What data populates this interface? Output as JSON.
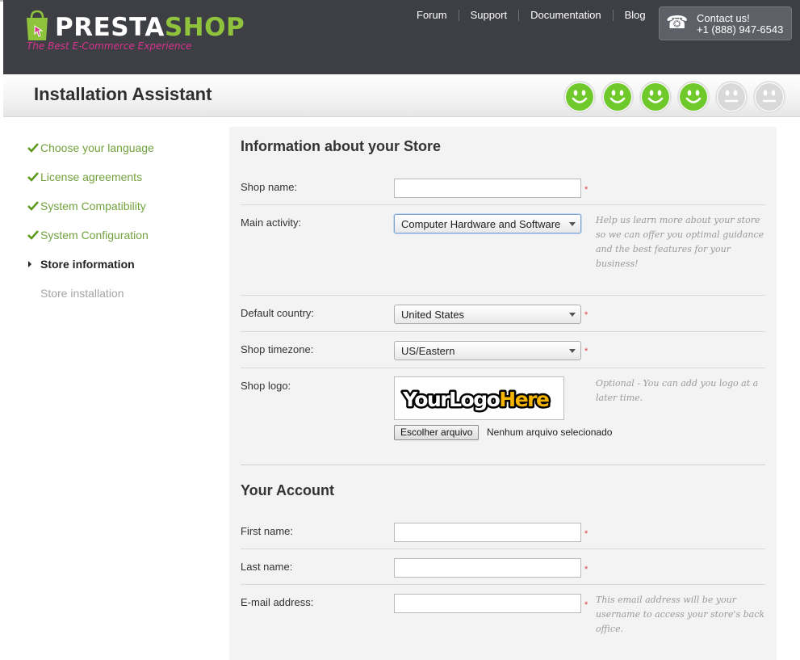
{
  "header": {
    "logo_word_1": "PRESTA",
    "logo_word_2": "SHOP",
    "logo_tagline": "The Best E-Commerce Experience",
    "nav": [
      {
        "label": "Forum"
      },
      {
        "label": "Support"
      },
      {
        "label": "Documentation"
      },
      {
        "label": "Blog"
      }
    ],
    "contact_label": "Contact us!",
    "contact_phone": "+1 (888) 947-6543"
  },
  "title": "Installation Assistant",
  "progress": {
    "completed": 4,
    "total": 6
  },
  "steps": [
    {
      "label": "Choose your language",
      "state": "done"
    },
    {
      "label": "License agreements",
      "state": "done"
    },
    {
      "label": "System Compatibility",
      "state": "done"
    },
    {
      "label": "System Configuration",
      "state": "done"
    },
    {
      "label": "Store information",
      "state": "current"
    },
    {
      "label": "Store installation",
      "state": "future"
    }
  ],
  "store": {
    "title": "Information about your Store",
    "shop_name_label": "Shop name:",
    "shop_name_value": "",
    "activity_label": "Main activity:",
    "activity_value": "Computer Hardware and Software",
    "activity_hint": "Help us learn more about your store so we can offer you optimal guidance and the best features for your business!",
    "country_label": "Default country:",
    "country_value": "United States",
    "timezone_label": "Shop timezone:",
    "timezone_value": "US/Eastern",
    "logo_label": "Shop logo:",
    "logo_text_1": "YourLogo",
    "logo_text_2": "Here",
    "logo_hint": "Optional - You can add you logo at a later time.",
    "file_button": "Escolher arquivo",
    "file_none": "Nenhum arquivo selecionado",
    "required_mark": "*"
  },
  "account": {
    "title": "Your Account",
    "first_name_label": "First name:",
    "last_name_label": "Last name:",
    "email_label": "E-mail address:",
    "email_hint": "This email address will be your username to access your store's back office."
  },
  "colors": {
    "header_bg": "#3d3f44",
    "accent_green": "#8fc33c",
    "step_green": "#72a23d",
    "tagline_pink": "#d8338e",
    "smiley_done": "#6fc92a",
    "smiley_todo": "#d9d9d9"
  }
}
